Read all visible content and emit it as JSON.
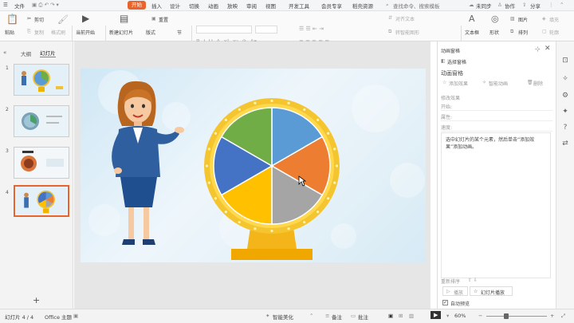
{
  "menu": {
    "file": "文件",
    "tabs": [
      "开始",
      "插入",
      "设计",
      "切换",
      "动画",
      "放映",
      "审阅",
      "视图",
      "开发工具",
      "会员专享",
      "稻壳资源"
    ],
    "search_placeholder": "查找命令、搜索模板",
    "sync": "未同步",
    "collab": "协作",
    "share": "分享"
  },
  "ribbon": {
    "paste": "粘贴",
    "cut": "剪切",
    "copy": "复制",
    "format_painter": "格式刷",
    "current_start": "当前开始",
    "new_slide": "新建幻灯片",
    "layout": "版式",
    "section": "节",
    "reset": "重置",
    "align_text": "对齐文本",
    "convert_smartart": "转智能图形",
    "textbox": "文本框",
    "shape": "形状",
    "arrange": "排列",
    "picture": "图片",
    "fill": "填充",
    "outline": "轮廓"
  },
  "left": {
    "tab_outline": "大纲",
    "tab_slides": "幻灯片",
    "slides": [
      "1",
      "2",
      "3",
      "4"
    ],
    "add": "+"
  },
  "anim_panel": {
    "title": "动画窗格",
    "select_pane": "选择窗格",
    "heading": "动画窗格",
    "add_effect": "添加效果",
    "smart_anim": "智能动画",
    "delete": "删除",
    "modify_effect": "修改效果",
    "start": "开始:",
    "property": "属性:",
    "speed": "速度:",
    "hint": "选中幻灯片的某个元素，然后单击“添加效果”添加动画。",
    "reorder": "重新排序",
    "play": "播放",
    "slideshow": "幻灯片播放",
    "autopreview": "自动预览"
  },
  "status": {
    "slide_count": "幻灯片 4 / 4",
    "theme": "Office 主题",
    "smart_beautify": "智能美化",
    "notes": "备注",
    "comments": "批注",
    "zoom": "60%"
  },
  "wheel_colors": [
    "#5b9bd5",
    "#ed7d31",
    "#a5a5a5",
    "#ffc000",
    "#4472c4",
    "#70ad47"
  ],
  "accent": "#e8642c"
}
